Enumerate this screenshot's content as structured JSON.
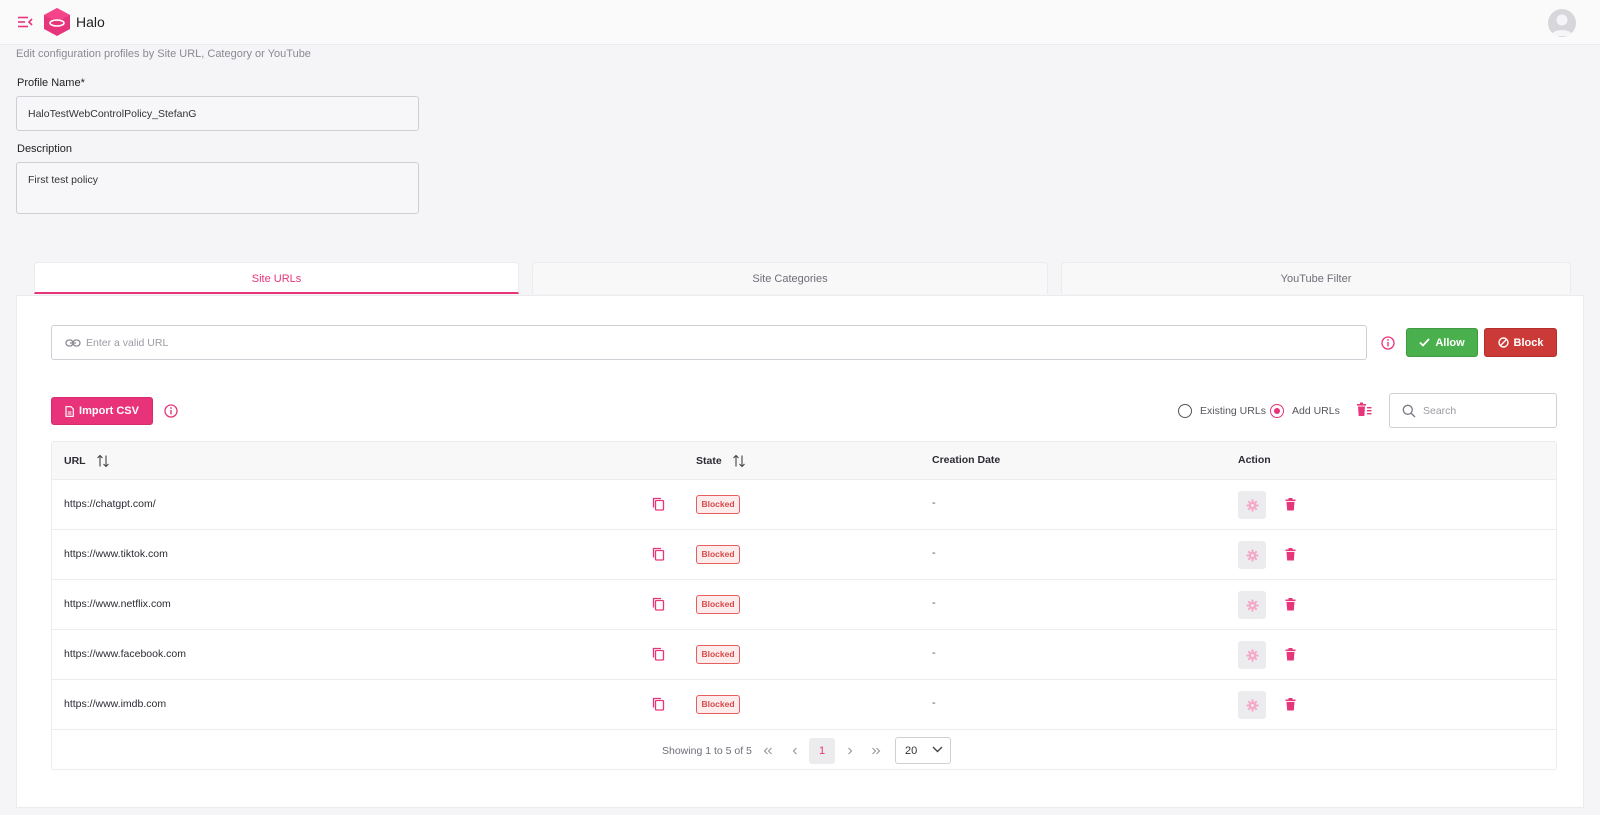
{
  "header": {
    "brand": "Halo",
    "icons": {
      "menu": "menu-collapse-icon",
      "logo": "halo-logo-icon",
      "avatar": "user-avatar-icon"
    },
    "accent_color": "#e6357a"
  },
  "page": {
    "subtitle": "Edit configuration profiles by Site URL, Category or YouTube"
  },
  "form": {
    "profile_name_label": "Profile Name*",
    "profile_name_value": "HaloTestWebControlPolicy_StefanG",
    "description_label": "Description",
    "description_value": "First test policy"
  },
  "tabs": [
    {
      "label": "Site URLs",
      "active": true
    },
    {
      "label": "Site Categories",
      "active": false
    },
    {
      "label": "YouTube Filter",
      "active": false
    }
  ],
  "url_entry": {
    "placeholder": "Enter a valid URL",
    "allow_label": "Allow",
    "block_label": "Block",
    "allow_color": "#49b04d",
    "block_color": "#cc3a37"
  },
  "toolbar": {
    "import_label": "Import CSV",
    "radio_existing_label": "Existing URLs",
    "radio_add_label": "Add URLs",
    "selected_radio": "Add URLs",
    "search_placeholder": "Search"
  },
  "table": {
    "columns": [
      "URL",
      "State",
      "Creation Date",
      "Action"
    ],
    "rows": [
      {
        "url": "https://chatgpt.com/",
        "state": "Blocked",
        "date": "-"
      },
      {
        "url": "https://www.tiktok.com",
        "state": "Blocked",
        "date": "-"
      },
      {
        "url": "https://www.netflix.com",
        "state": "Blocked",
        "date": "-"
      },
      {
        "url": "https://www.facebook.com",
        "state": "Blocked",
        "date": "-"
      },
      {
        "url": "https://www.imdb.com",
        "state": "Blocked",
        "date": "-"
      }
    ]
  },
  "pagination": {
    "summary": "Showing 1 to 5 of 5",
    "current_page": "1",
    "page_size": "20"
  }
}
